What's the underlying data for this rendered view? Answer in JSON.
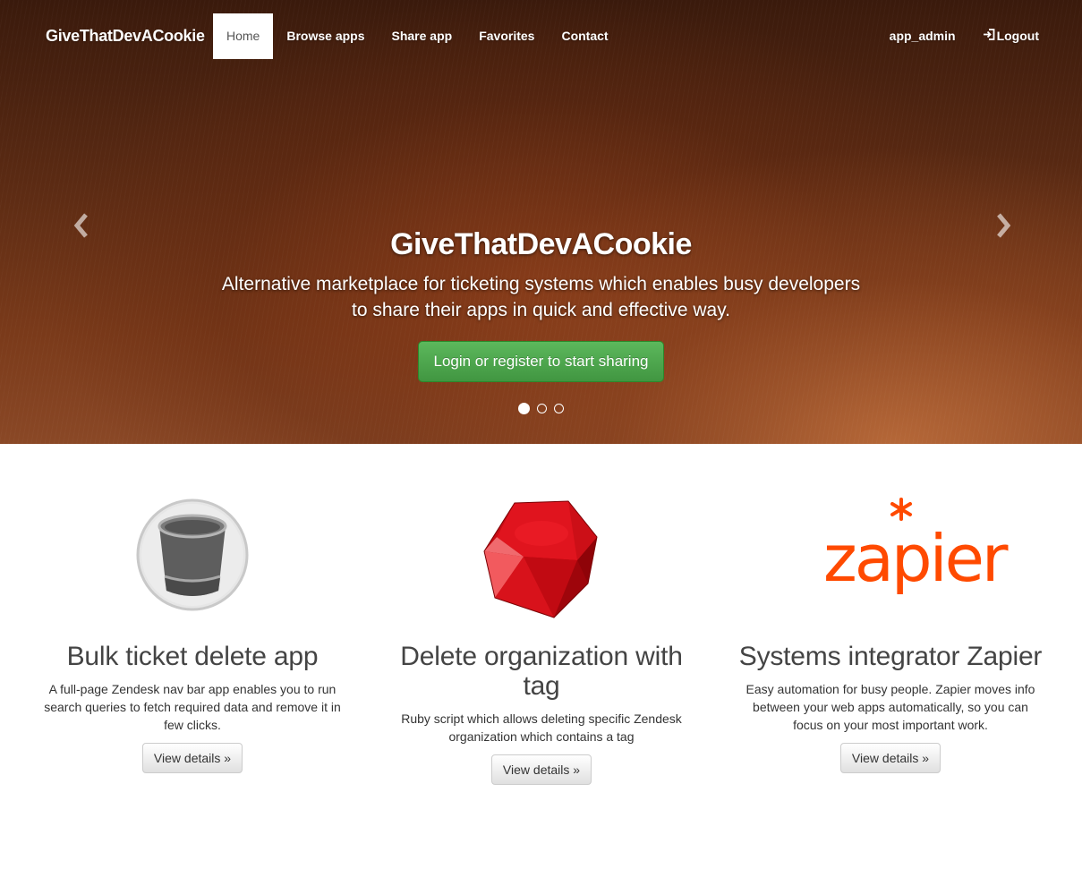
{
  "navbar": {
    "brand": "GiveThatDevACookie",
    "items": [
      {
        "label": "Home",
        "active": true
      },
      {
        "label": "Browse apps",
        "active": false
      },
      {
        "label": "Share app",
        "active": false
      },
      {
        "label": "Favorites",
        "active": false
      },
      {
        "label": "Contact",
        "active": false
      }
    ],
    "user": "app_admin",
    "logout_label": "Logout"
  },
  "carousel": {
    "title": "GiveThatDevACookie",
    "tagline_line1": "Alternative marketplace for ticketing systems which enables busy developers",
    "tagline_line2": "to share their apps in quick and effective way.",
    "cta_label": "Login or register to start sharing",
    "slide_count": 3,
    "active_slide": 1,
    "prev_icon": "chevron-left-icon",
    "next_icon": "chevron-right-icon"
  },
  "features": [
    {
      "title": "Bulk ticket delete app",
      "description": "A full-page Zendesk nav bar app enables you to run search queries to fetch required data and remove it in few clicks.",
      "button": "View details »",
      "icon": "trash-can-icon"
    },
    {
      "title": "Delete organization with tag",
      "description": "Ruby script which allows deleting specific Zendesk organization which contains a tag",
      "button": "View details »",
      "icon": "ruby-gem-icon"
    },
    {
      "title": "Systems integrator Zapier",
      "description": "Easy automation for busy people. Zapier moves info between your web apps automatically, so you can focus on your most important work.",
      "button": "View details »",
      "icon": "zapier-logo",
      "logo_text": "zapier"
    }
  ],
  "colors": {
    "hero_brown": "#5a2a13",
    "cta_green": "#5cb85c",
    "zapier_orange": "#ff4a00",
    "ruby_red": "#e0141e"
  }
}
